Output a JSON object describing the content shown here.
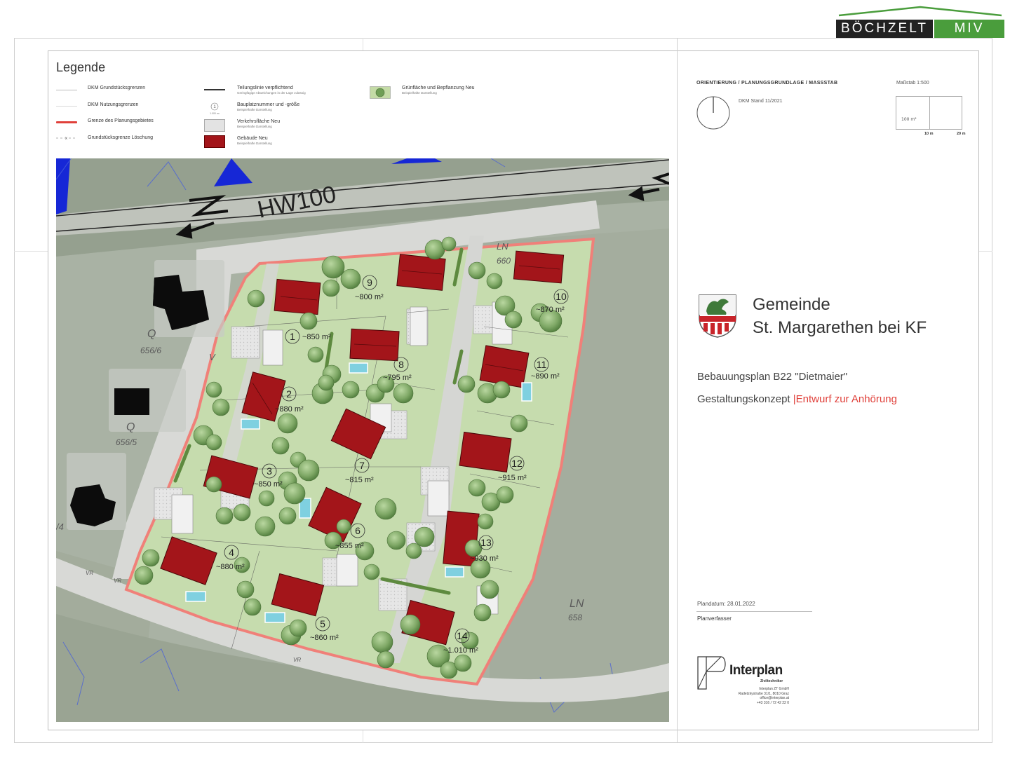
{
  "logo": {
    "left": "BÖCHZELT",
    "right": "MIV"
  },
  "legend": {
    "title": "Legende",
    "items": [
      {
        "label": "DKM Grundstücksgrenzen",
        "sub": ""
      },
      {
        "label": "DKM Nutzungsgrenzen",
        "sub": ""
      },
      {
        "label": "Grenze des Planungsgebietes",
        "sub": ""
      },
      {
        "label": "Grundstücksgrenze Löschung",
        "sub": ""
      },
      {
        "label": "Teilungslinie verpflichtend",
        "sub": "Geringfügige Abweichungen in der Lage zulässig"
      },
      {
        "label": "Bauplatznummer und -größe",
        "sub": "Beispielhafte Darstellung"
      },
      {
        "label": "Verkehrsfläche Neu",
        "sub": "Beispielhafte Darstellung"
      },
      {
        "label": "Gebäude Neu",
        "sub": "Beispielhafte Darstellung"
      },
      {
        "label": "Grünfläche und Bepflanzung Neu",
        "sub": "Beispielhafte Darstellung"
      }
    ],
    "symbol_number": "1",
    "symbol_area": "1.000 m²",
    "colors": {
      "boundary": "#e0403a",
      "building": "#a3151a",
      "green": "#a9c98a"
    }
  },
  "map": {
    "hw_label": "HW100",
    "plots": [
      {
        "num": "1",
        "area": "~850 m²"
      },
      {
        "num": "2",
        "area": "~880 m²"
      },
      {
        "num": "3",
        "area": "~850 m²"
      },
      {
        "num": "4",
        "area": "~880 m²"
      },
      {
        "num": "5",
        "area": "~860 m²"
      },
      {
        "num": "6",
        "area": "~855 m²"
      },
      {
        "num": "7",
        "area": "~815 m²"
      },
      {
        "num": "8",
        "area": "~795 m²"
      },
      {
        "num": "9",
        "area": "~800 m²"
      },
      {
        "num": "10",
        "area": "~870 m²"
      },
      {
        "num": "11",
        "area": "~890 m²"
      },
      {
        "num": "12",
        "area": "~915 m²"
      },
      {
        "num": "13",
        "area": "~930 m²"
      },
      {
        "num": "14",
        "area": "~1.010 m²"
      }
    ],
    "cadastre": [
      {
        "code": "Q",
        "num": "656/6"
      },
      {
        "code": "Q",
        "num": "656/5"
      },
      {
        "code": "LN",
        "num": "660"
      },
      {
        "code": "LN",
        "num": "658"
      }
    ],
    "small_labels": {
      "v": "V",
      "vr1": "VR",
      "vr2": "VR",
      "vr3": "VR",
      "four": "/4"
    }
  },
  "panel": {
    "orientation_heading": "ORIENTIERUNG / PLANUNGSGRUNDLAGE / MASSSTAB",
    "scale": "Maßstab 1:500",
    "dkm": "DKM Stand 11/2021",
    "area_label": "100 m²",
    "tick_10": "10 m",
    "tick_20": "20 m",
    "municipality_line1": "Gemeinde",
    "municipality_line2": "St. Margarethen bei KF",
    "plan_title": "Bebauungsplan B22 \"Dietmaier\"",
    "concept": "Gestaltungskonzept",
    "separator": "|",
    "draft": "Entwurf zur Anhörung",
    "plan_date": "Plandatum: 28.01.2022",
    "planner_label": "Planverfasser",
    "planner_name": "Interplan",
    "planner_sub": "Ziviltechniker",
    "planner_address": [
      "Interplan ZT GmbH",
      "Radetzkystraße 31/1, 8010 Graz",
      "office@interplan.at",
      "+43 316 / 72 42 22 0"
    ]
  }
}
